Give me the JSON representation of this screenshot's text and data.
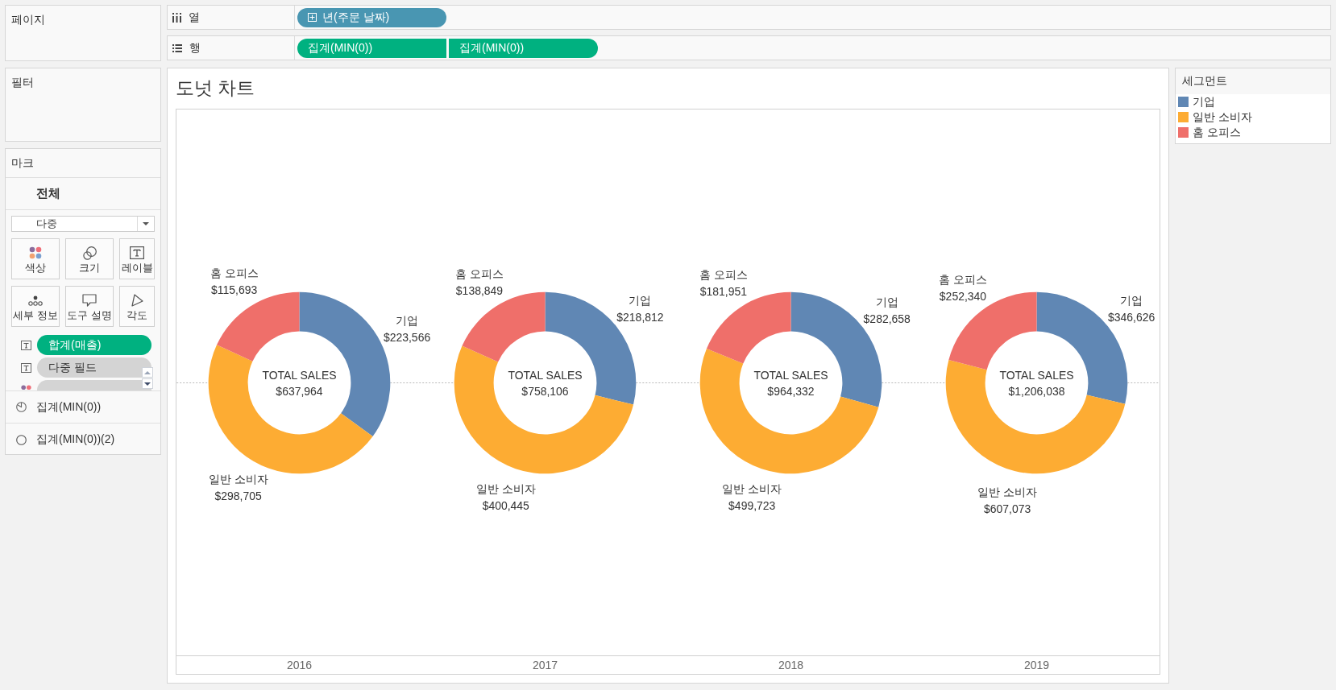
{
  "pages": {
    "title": "페이지"
  },
  "shelves": [
    {
      "kind": "columns",
      "label": "열",
      "pills": [
        {
          "text": "년(주문 날짜)",
          "color": "#4996b2",
          "expandable": true
        }
      ]
    },
    {
      "kind": "rows",
      "label": "행",
      "pills": [
        {
          "text": "집계(MIN(0))",
          "color": "#00b180",
          "expandable": false
        },
        {
          "text": "집계(MIN(0))",
          "color": "#00b180",
          "expandable": false
        }
      ]
    }
  ],
  "filters": {
    "title": "필터"
  },
  "marks": {
    "title": "마크",
    "layer": "전체",
    "mark_type": "다중",
    "properties": [
      {
        "kind": "color",
        "label": "색상"
      },
      {
        "kind": "size",
        "label": "크기"
      },
      {
        "kind": "label",
        "label": "레이블"
      },
      {
        "kind": "detail",
        "label": "세부 정보"
      },
      {
        "kind": "tooltip",
        "label": "도구 설명"
      },
      {
        "kind": "angle",
        "label": "각도"
      }
    ],
    "fields": [
      {
        "kind": "label",
        "color": "#00b180",
        "text": "합계(매출)"
      },
      {
        "kind": "label",
        "color": "#d4d4d4",
        "text": "다중 필드"
      },
      {
        "kind": "color",
        "color": "#d4d4d4"
      }
    ],
    "layers": [
      {
        "kind": "pie",
        "label": "집계(MIN(0))"
      },
      {
        "kind": "circle",
        "label": "집계(MIN(0))(2)"
      }
    ]
  },
  "worksheet": {
    "title": "도넛 차트",
    "chart_data": [
      {
        "type": "donut",
        "xlabel": "2016",
        "categories": [
          "기업",
          "일반 소비자",
          "홈 오피스"
        ],
        "values": [
          223566,
          298705,
          115693
        ],
        "colors": [
          "#6087b4",
          "#fdac33",
          "#ef6f6a"
        ],
        "value_labels": [
          "$223,566",
          "$298,705",
          "$115,693"
        ],
        "annotations": [
          "TOTAL SALES",
          "$637,964"
        ]
      },
      {
        "type": "donut",
        "xlabel": "2017",
        "categories": [
          "기업",
          "일반 소비자",
          "홈 오피스"
        ],
        "values": [
          218812,
          400445,
          138849
        ],
        "colors": [
          "#6087b4",
          "#fdac33",
          "#ef6f6a"
        ],
        "value_labels": [
          "$218,812",
          "$400,445",
          "$138,849"
        ],
        "annotations": [
          "TOTAL SALES",
          "$758,106"
        ]
      },
      {
        "type": "donut",
        "xlabel": "2018",
        "categories": [
          "기업",
          "일반 소비자",
          "홈 오피스"
        ],
        "values": [
          282658,
          499723,
          181951
        ],
        "colors": [
          "#6087b4",
          "#fdac33",
          "#ef6f6a"
        ],
        "value_labels": [
          "$282,658",
          "$499,723",
          "$181,951"
        ],
        "annotations": [
          "TOTAL SALES",
          "$964,332"
        ]
      },
      {
        "type": "donut",
        "xlabel": "2019",
        "categories": [
          "기업",
          "일반 소비자",
          "홈 오피스"
        ],
        "values": [
          346626,
          607073,
          252340
        ],
        "colors": [
          "#6087b4",
          "#fdac33",
          "#ef6f6a"
        ],
        "value_labels": [
          "$346,626",
          "$607,073",
          "$252,340"
        ],
        "annotations": [
          "TOTAL SALES",
          "$1,206,038"
        ]
      }
    ]
  },
  "legend": {
    "title": "세그먼트",
    "items": [
      {
        "label": "기업",
        "color": "#6087b4"
      },
      {
        "label": "일반 소비자",
        "color": "#fdac33"
      },
      {
        "label": "홈 오피스",
        "color": "#ef6f6a"
      }
    ]
  }
}
